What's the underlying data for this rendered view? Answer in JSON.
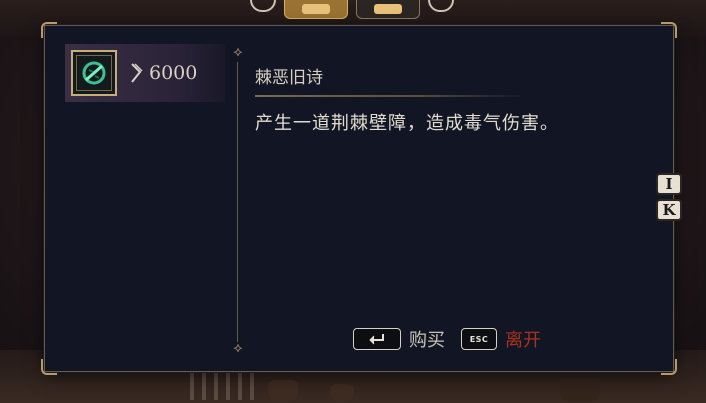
{
  "shop": {
    "items": [
      {
        "name": "棘恶旧诗",
        "price": "6000",
        "currency_icon": "rune-currency-icon",
        "icon": "thorn-spell-icon"
      }
    ]
  },
  "detail": {
    "title": "棘恶旧诗",
    "description": "产生一道荆棘壁障，造成毒气伤害。"
  },
  "footer": {
    "buy_label": "购买",
    "leave_label": "离开",
    "esc_key": "ESC"
  },
  "side_keys": [
    "I",
    "K"
  ],
  "colors": {
    "panel_bg": "#121624",
    "gold_trim": "#b99a6a",
    "leave_red": "#a8321e",
    "selected_item_bg": "#3a2f44"
  }
}
